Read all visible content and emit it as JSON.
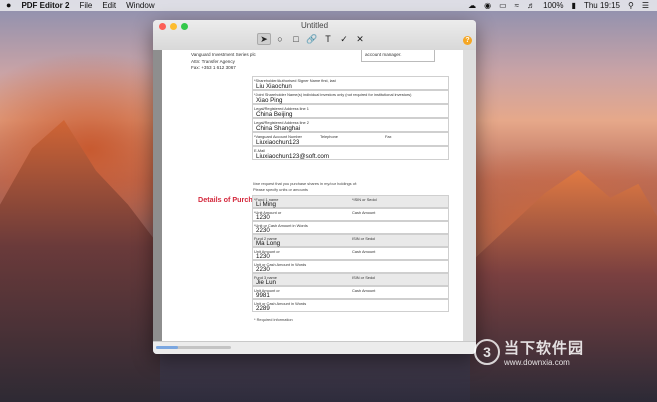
{
  "menubar": {
    "apple": "",
    "app_name": "PDF Editor 2",
    "items": [
      "File",
      "Edit",
      "Window"
    ],
    "battery": "100%",
    "clock": "Thu 19:15"
  },
  "window": {
    "title": "Untitled",
    "help": "?",
    "tools": [
      "arrow-select-icon",
      "ellipse-icon",
      "rectangle-icon",
      "link-icon",
      "text-icon",
      "check-icon",
      "cross-icon"
    ]
  },
  "document": {
    "address_lines": [
      "Vanguard Investment Series plc",
      "Attn: Transfer Agency",
      "Fax: +353 1 612 3067"
    ],
    "account_box": "account manager.",
    "signer": {
      "label": "*Shareholder/Authorised Signer Name first, last",
      "value": "Liu Xiaochun"
    },
    "joint": {
      "label": "*Joint Shareholder Name(s) individual investors only (not required for institutional investors)",
      "value": "Xiao Ping"
    },
    "addr1": {
      "label": "Legal/Registered Address line 1",
      "value": "China Beijing"
    },
    "addr2": {
      "label": "Legal/Registered Address line 2",
      "value": "China Shanghai"
    },
    "account_row": {
      "label_account": "*Vanguard Account Number",
      "label_phone": "Telephone",
      "label_fax": "Fax",
      "value": "Liuxiaochun123"
    },
    "email": {
      "label": "E-Mail",
      "value": "Liuxiaochun123@soft.com"
    },
    "purchase_title": "Details of Purchase Request",
    "purchase_note1": "I/we request that you purchase shares in my/our holdings of:",
    "purchase_note2": "Please specify units or amounts",
    "funds": [
      {
        "name_label": "*Fund 1 name",
        "isin_label": "*ISIN or Sedol",
        "name": "Li Ming",
        "unit_label": "*Unit Amount or",
        "cash_label": "Cash Amount",
        "unit": "1230",
        "words_label": "*Unit or Cash Amount in Words",
        "words": "2230"
      },
      {
        "name_label": "Fund 2 name",
        "isin_label": "ISIN or Sedol",
        "name": "Ma Long",
        "unit_label": "Unit Amount or",
        "cash_label": "Cash Amount",
        "unit": "1230",
        "words_label": "Unit or Cash Amount in Words",
        "words": "2230"
      },
      {
        "name_label": "Fund 3 name",
        "isin_label": "ISIN or Sedol",
        "name": "Jie Lun",
        "unit_label": "Unit Amount or",
        "cash_label": "Cash Amount",
        "unit": "9981",
        "words_label": "Unit or Cash Amount in Words",
        "words": "2289"
      }
    ],
    "required_note": "* Required information"
  },
  "watermark": {
    "badge": "3",
    "text": "当下软件园",
    "url": "www.downxia.com"
  }
}
